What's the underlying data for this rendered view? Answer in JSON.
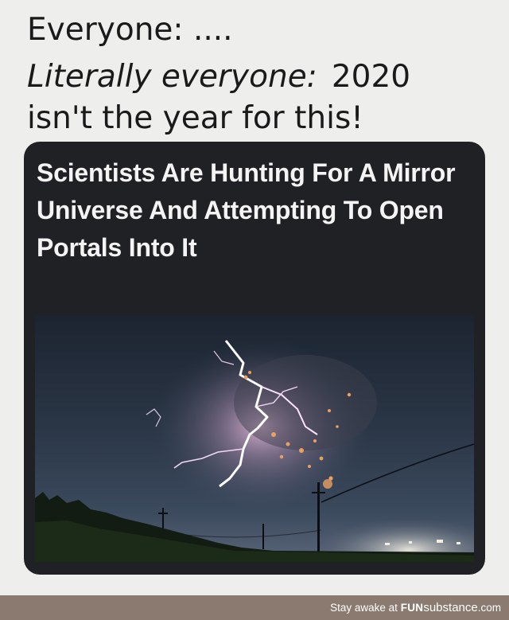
{
  "caption": {
    "line1": "Everyone: ....",
    "line2_italic": "Literally everyone:",
    "line2_year": "2020",
    "line3": "isn't the year for this!"
  },
  "article": {
    "headline": "Scientists Are Hunting For A Mirror Universe And Attempting To Open Portals Into It"
  },
  "watermark": {
    "prefix": "Stay awake at ",
    "brand_bold": "FUN",
    "brand_rest": "substance",
    "suffix": ".com"
  }
}
